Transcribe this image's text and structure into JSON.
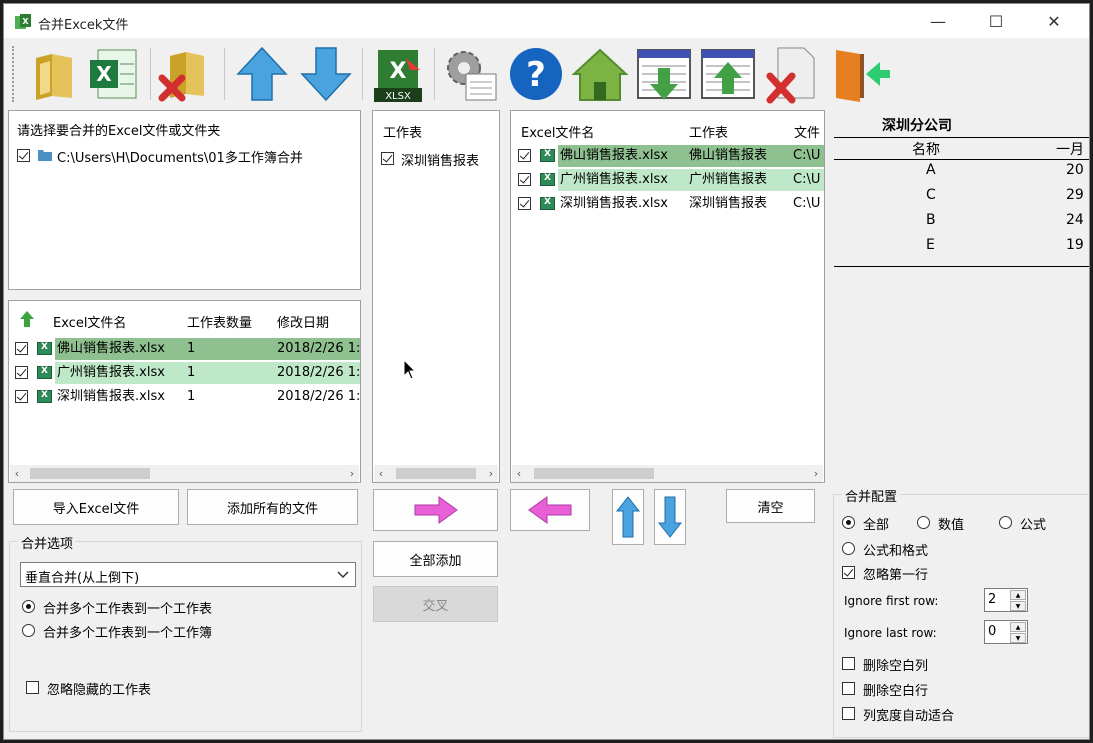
{
  "window": {
    "title": "合并Excek文件",
    "minimize": "—",
    "maximize": "☐",
    "close": "✕"
  },
  "toolbar": {
    "icons": [
      "open-folder-icon",
      "excel-file-icon",
      "remove-folder-icon",
      "move-up-icon",
      "move-down-icon",
      "export-xlsx-icon",
      "settings-icon",
      "help-icon",
      "home-icon",
      "import-sheet-icon",
      "export-sheet-icon",
      "delete-file-icon",
      "exit-icon"
    ]
  },
  "folder_panel": {
    "label": "请选择要合并的Excel文件或文件夹",
    "path": "C:\\Users\\H\\Documents\\01多工作簿合并"
  },
  "file_table": {
    "columns": [
      "Excel文件名",
      "工作表数量",
      "修改日期"
    ],
    "rows": [
      {
        "name": "佛山销售报表.xlsx",
        "count": "1",
        "date": "2018/2/26 1:",
        "style": "dark"
      },
      {
        "name": "广州销售报表.xlsx",
        "count": "1",
        "date": "2018/2/26 1:",
        "style": "light"
      },
      {
        "name": "深圳销售报表.xlsx",
        "count": "1",
        "date": "2018/2/26 1:",
        "style": "none"
      }
    ]
  },
  "sheet_panel": {
    "header": "工作表",
    "items": [
      "深圳销售报表"
    ]
  },
  "selected_table": {
    "columns": [
      "Excel文件名",
      "工作表",
      "文件"
    ],
    "rows": [
      {
        "name": "佛山销售报表.xlsx",
        "sheet": "佛山销售报表",
        "path": "C:\\U",
        "style": "dark"
      },
      {
        "name": "广州销售报表.xlsx",
        "sheet": "广州销售报表",
        "path": "C:\\U",
        "style": "light"
      },
      {
        "name": "深圳销售报表.xlsx",
        "sheet": "深圳销售报表",
        "path": "C:\\U",
        "style": "none"
      }
    ]
  },
  "preview": {
    "title": "深圳分公司",
    "headers": [
      "名称",
      "一月"
    ],
    "rows": [
      [
        "A",
        "20"
      ],
      [
        "C",
        "29"
      ],
      [
        "B",
        "24"
      ],
      [
        "E",
        "19"
      ]
    ]
  },
  "buttons": {
    "import_excel": "导入Excel文件",
    "add_all_files": "添加所有的文件",
    "add_all": "全部添加",
    "cross": "交叉",
    "clear": "清空"
  },
  "merge_options": {
    "title": "合并选项",
    "mode": "垂直合并(从上倒下)",
    "radio1": "合并多个工作表到一个工作表",
    "radio2": "合并多个工作表到一个工作簿",
    "ignore_hidden": "忽略隐藏的工作表"
  },
  "merge_config": {
    "title": "合并配置",
    "opt_all": "全部",
    "opt_value": "数值",
    "opt_formula": "公式",
    "opt_formula_format": "公式和格式",
    "ignore_first_row": "忽略第一行",
    "ignore_first_row_label": "Ignore first row:",
    "ignore_first_row_value": "2",
    "ignore_last_row_label": "Ignore last row:",
    "ignore_last_row_value": "0",
    "delete_blank_cols": "删除空白列",
    "delete_blank_rows": "删除空白行",
    "autofit_cols": "列宽度自动适合"
  },
  "colors": {
    "row_dark": "#8fc08f",
    "row_light": "#bfe8c8",
    "accent_arrow": "#e85fd6"
  }
}
